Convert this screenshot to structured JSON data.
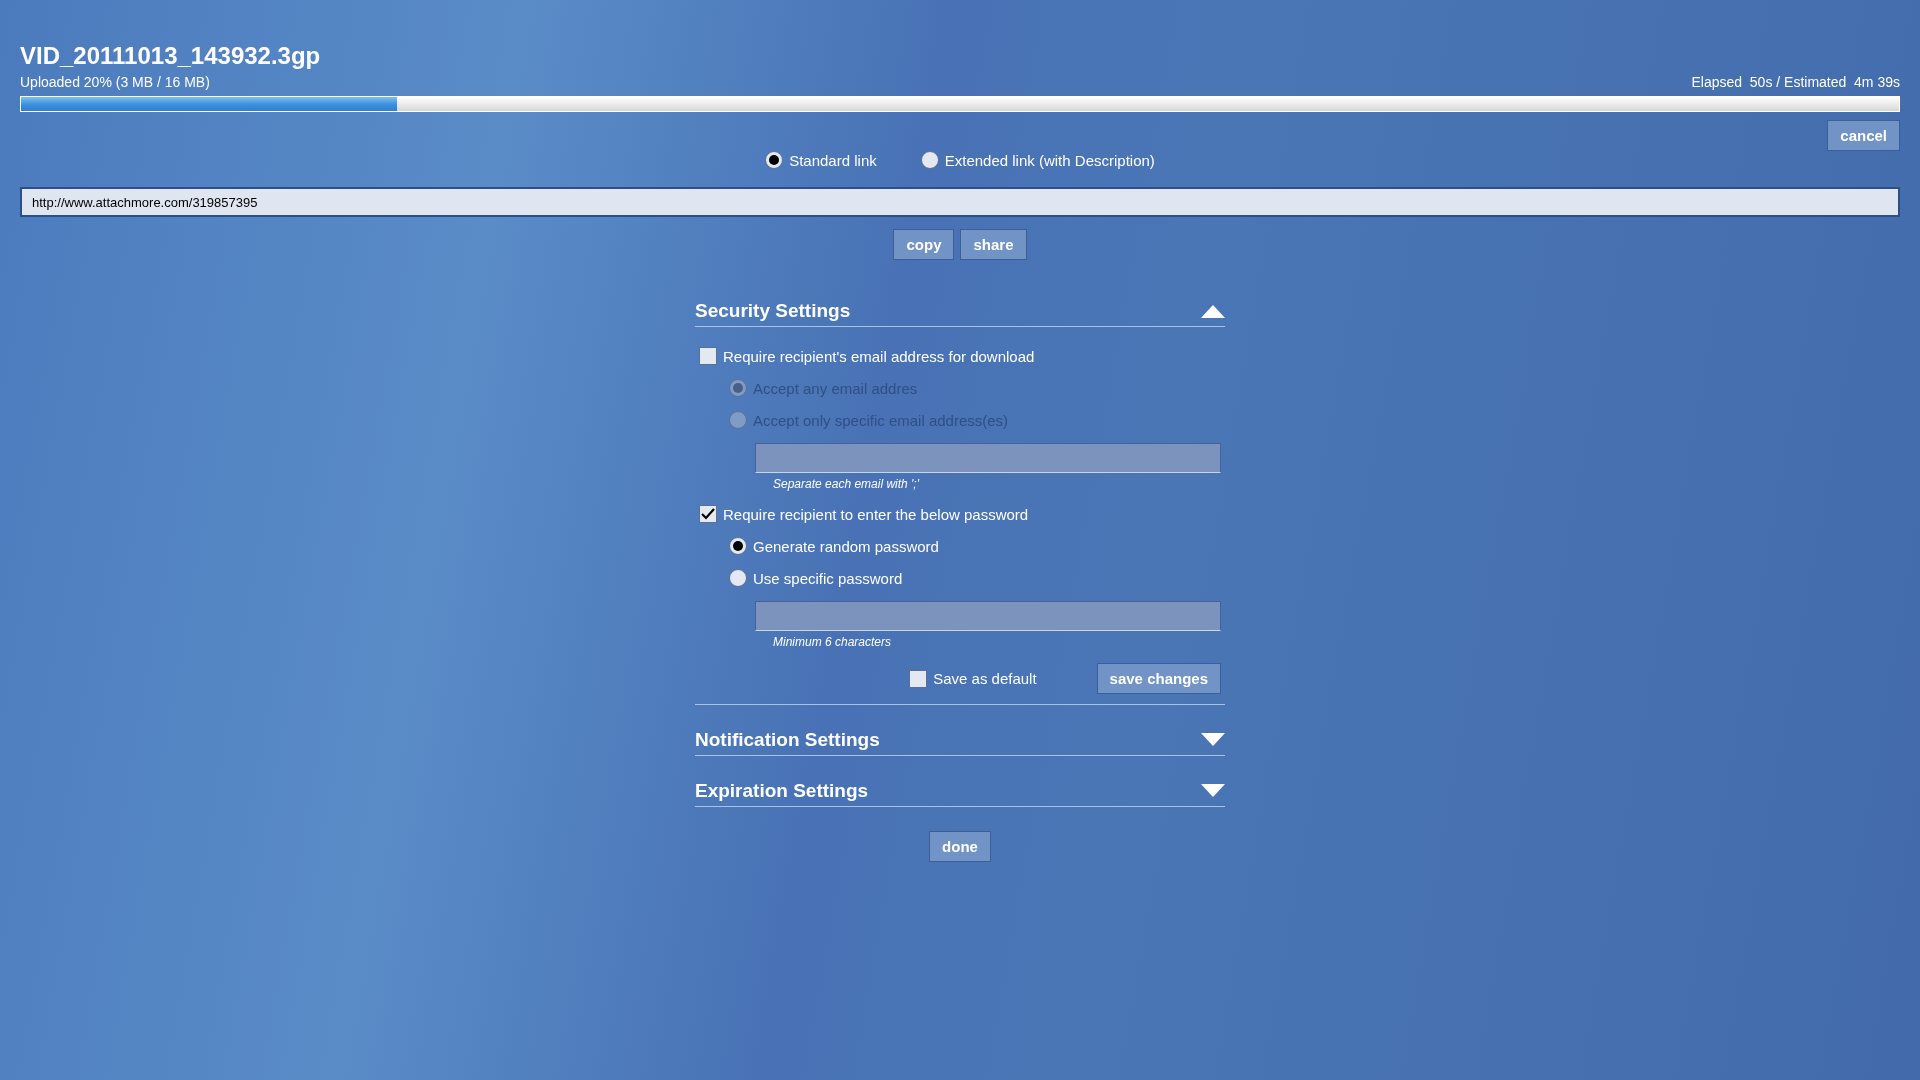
{
  "file": {
    "name": "VID_20111013_143932.3gp",
    "status": "Uploaded 20% (3 MB / 16 MB)",
    "timing": "Elapsed  50s / Estimated  4m 39s",
    "level": 0.2
  },
  "cancel_button": "cancel",
  "link_types": [
    {
      "label": "Standard link",
      "selected": true
    },
    {
      "label": "Extended link (with Description)",
      "selected": false
    }
  ],
  "link": {
    "value": "http://www.attachmore.com/319857395"
  },
  "link_actions": [
    "copy",
    "share"
  ],
  "sections": [
    {
      "title": "Security Settings",
      "expanded": true,
      "options": [
        {
          "kind": "checkbox",
          "label": "Require recipient's email address for download",
          "checked": false,
          "children": [
            {
              "kind": "radio",
              "label": "Accept any email addres",
              "selected": true,
              "disabled": true
            },
            {
              "kind": "radio",
              "label": "Accept only specific email address(es)",
              "selected": false,
              "disabled": true
            },
            {
              "kind": "field",
              "note": "Separate each email with ';'"
            }
          ]
        },
        {
          "kind": "checkbox",
          "label": "Require recipient to enter the below password",
          "checked": true,
          "children": [
            {
              "kind": "radio",
              "label": "Generate random password",
              "selected": true,
              "disabled": false
            },
            {
              "kind": "radio",
              "label": "Use specific password",
              "selected": false,
              "disabled": false
            },
            {
              "kind": "field",
              "note": "Minimum 6 characters"
            }
          ]
        }
      ],
      "footer": {
        "default_checkbox": {
          "label": "Save as default",
          "checked": false
        },
        "save_button": "save changes"
      }
    },
    {
      "title": "Notification Settings",
      "expanded": false
    },
    {
      "title": "Expiration Settings",
      "expanded": false
    }
  ],
  "done_button": "done"
}
